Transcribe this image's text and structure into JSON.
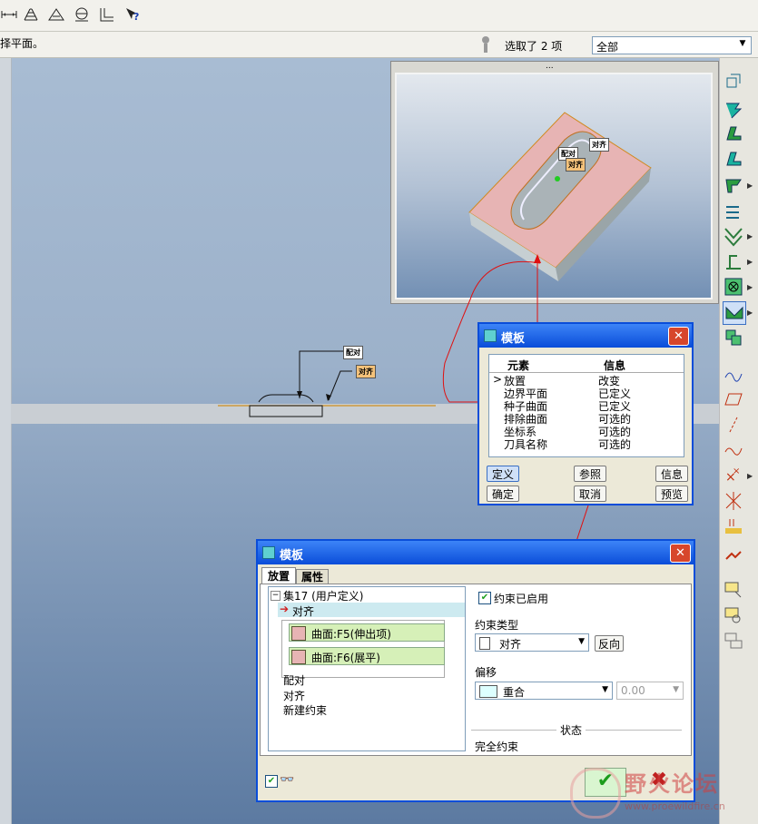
{
  "toolbar": {
    "icons": [
      "dimension-icon",
      "datum-plane-icon",
      "surface-icon",
      "measure-icon",
      "axis-icon",
      "whats-this-icon"
    ]
  },
  "status": {
    "message": "择平面。",
    "selected_count": "选取了 2 项",
    "filter_value": "全部"
  },
  "preview": {
    "dots": "...",
    "tag_peidui": "配对",
    "tag_duiqi": "对齐",
    "tag_duiqi_white": "对齐"
  },
  "canvas_tags": {
    "peidui": "配对",
    "duiqi": "对齐"
  },
  "template_small": {
    "title": "模板",
    "close": "✕",
    "columns": [
      "元素",
      "信息"
    ],
    "rows": [
      {
        "element": "放置",
        "info": "改变"
      },
      {
        "element": "边界平面",
        "info": "已定义"
      },
      {
        "element": "种子曲面",
        "info": "已定义"
      },
      {
        "element": "排除曲面",
        "info": "可选的"
      },
      {
        "element": "坐标系",
        "info": "可选的"
      },
      {
        "element": "刀具名称",
        "info": "可选的"
      }
    ],
    "buttons": {
      "define": "定义",
      "reference": "参照",
      "info": "信息",
      "ok": "确定",
      "cancel": "取消",
      "preview": "预览"
    }
  },
  "template_big": {
    "title": "模板",
    "close": "✕",
    "tabs": [
      "放置",
      "属性"
    ],
    "tree": {
      "set_label": "集17 (用户定义)",
      "active_constraint": "对齐",
      "ref1": "曲面:F5(伸出项)",
      "ref2": "曲面:F6(展平)",
      "items": [
        "配对",
        "对齐",
        "新建约束"
      ]
    },
    "constraint_enabled": "约束已启用",
    "constraint_type_label": "约束类型",
    "constraint_type_value": "对齐",
    "flip_button": "反向",
    "offset_label": "偏移",
    "offset_value": "重合",
    "offset_number": "0.00",
    "status_label": "状态",
    "status_value": "完全约束",
    "glasses_icon_label": "👓"
  },
  "watermark": {
    "title": "野火论坛",
    "url": "www.proewildfire.cn"
  },
  "colors": {
    "titlebar": "#0a4dd9",
    "close": "#d7462b",
    "red_line": "#e01010"
  }
}
